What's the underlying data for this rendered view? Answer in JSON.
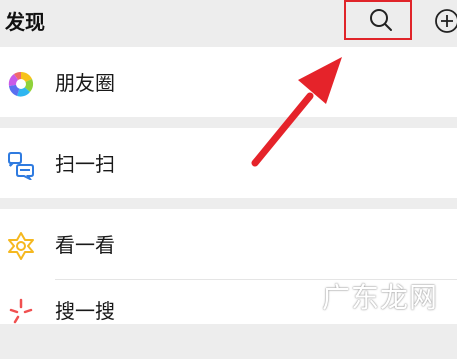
{
  "header": {
    "title": "发现"
  },
  "menu": {
    "moments": {
      "label": "朋友圈",
      "icon": "moments-icon"
    },
    "scan": {
      "label": "扫一扫",
      "icon": "scan-icon"
    },
    "top_stories": {
      "label": "看一看",
      "icon": "top-stories-icon"
    },
    "search": {
      "label": "搜一搜",
      "icon": "search-feature-icon"
    }
  },
  "watermark": "广东龙网",
  "colors": {
    "highlight": "#e0242a",
    "background": "#ededed",
    "card": "#ffffff"
  }
}
